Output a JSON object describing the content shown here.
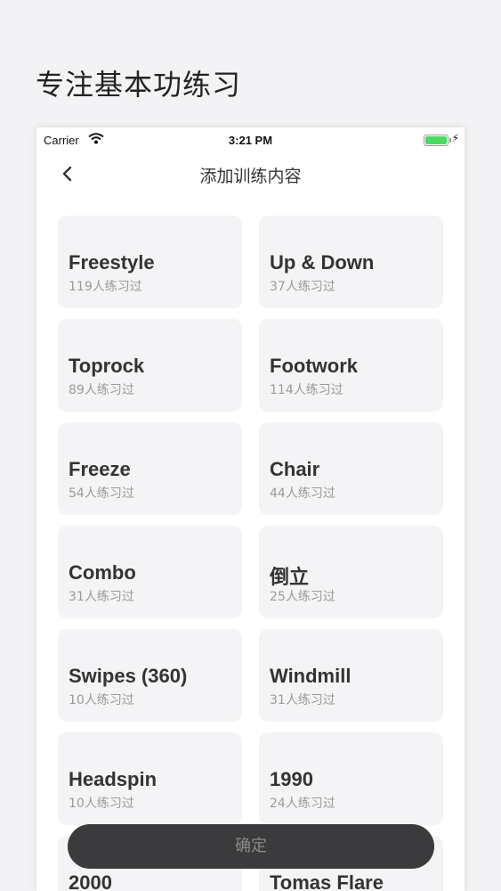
{
  "promo": {
    "title": "专注基本功练习"
  },
  "status_bar": {
    "carrier": "Carrier",
    "time": "3:21 PM"
  },
  "nav": {
    "title": "添加训练内容",
    "back_icon": "chevron-left-icon"
  },
  "moves": [
    {
      "name": "Freestyle",
      "count": "119人练习过"
    },
    {
      "name": "Up & Down",
      "count": "37人练习过"
    },
    {
      "name": "Toprock",
      "count": "89人练习过"
    },
    {
      "name": "Footwork",
      "count": "114人练习过"
    },
    {
      "name": "Freeze",
      "count": "54人练习过"
    },
    {
      "name": "Chair",
      "count": "44人练习过"
    },
    {
      "name": "Combo",
      "count": "31人练习过"
    },
    {
      "name": "倒立",
      "count": "25人练习过"
    },
    {
      "name": "Swipes (360)",
      "count": "10人练习过"
    },
    {
      "name": "Windmill",
      "count": "31人练习过"
    },
    {
      "name": "Headspin",
      "count": "10人练习过"
    },
    {
      "name": "1990",
      "count": "24人练习过"
    },
    {
      "name": "2000",
      "count": ""
    },
    {
      "name": "Tomas Flare",
      "count": ""
    }
  ],
  "confirm_button": {
    "label": "确定"
  },
  "colors": {
    "card_bg": "#f4f4f6",
    "battery": "#4cd964",
    "button_bg": "#3b3a3c"
  }
}
